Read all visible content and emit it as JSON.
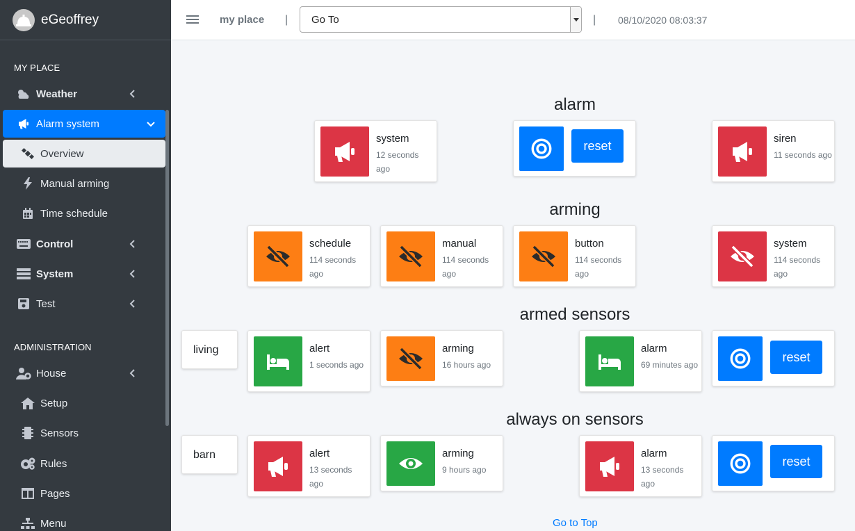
{
  "brand": {
    "name": "eGeoffrey",
    "logo_icon": "bell-icon"
  },
  "sidebar": {
    "header_myplace": "MY PLACE",
    "header_admin": "ADMINISTRATION",
    "items": [
      {
        "label": "Weather",
        "icon": "cloud-sun-icon"
      },
      {
        "label": "Alarm system",
        "icon": "bullhorn-icon"
      },
      {
        "label": "Overview",
        "icon": "satellite-icon"
      },
      {
        "label": "Manual arming",
        "icon": "bolt-icon"
      },
      {
        "label": "Time schedule",
        "icon": "calendar-icon"
      },
      {
        "label": "Control",
        "icon": "keyboard-icon"
      },
      {
        "label": "System",
        "icon": "server-icon"
      },
      {
        "label": "Test",
        "icon": "save-icon"
      },
      {
        "label": "House",
        "icon": "user-cog-icon"
      },
      {
        "label": "Setup",
        "icon": "home-icon"
      },
      {
        "label": "Sensors",
        "icon": "microchip-icon"
      },
      {
        "label": "Rules",
        "icon": "cogs-icon"
      },
      {
        "label": "Pages",
        "icon": "columns-icon"
      },
      {
        "label": "Menu",
        "icon": "sitemap-icon"
      }
    ]
  },
  "navbar": {
    "place": "my place",
    "separator": "|",
    "goto": "Go To",
    "datetime": "08/10/2020 08:03:37"
  },
  "colors": {
    "red": "#dc3545",
    "orange": "#fd7e14",
    "blue": "#007bff",
    "green": "#28a745",
    "sidebar": "#343a40"
  },
  "sections": {
    "alarm": {
      "title": "alarm",
      "system": {
        "title": "system",
        "time": "12 seconds ago",
        "icon": "bullhorn-icon"
      },
      "reset_label": "reset",
      "siren": {
        "title": "siren",
        "time": "11 seconds ago",
        "icon": "bullhorn-icon"
      }
    },
    "arming": {
      "title": "arming",
      "schedule": {
        "title": "schedule",
        "time": "114 seconds ago",
        "icon": "eye-slash-icon"
      },
      "manual": {
        "title": "manual",
        "time": "114 seconds ago",
        "icon": "eye-slash-icon"
      },
      "button": {
        "title": "button",
        "time": "114 seconds ago",
        "icon": "eye-slash-icon"
      },
      "system": {
        "title": "system",
        "time": "114 seconds ago",
        "icon": "eye-slash-icon"
      }
    },
    "armed": {
      "title": "armed sensors",
      "zone": "living",
      "alert": {
        "title": "alert",
        "time": "1 seconds ago",
        "icon": "bed-icon"
      },
      "arming": {
        "title": "arming",
        "time": "16 hours ago",
        "icon": "eye-slash-icon"
      },
      "alarm": {
        "title": "alarm",
        "time": "69 minutes ago",
        "icon": "bed-icon"
      },
      "reset_label": "reset"
    },
    "always": {
      "title": "always on sensors",
      "zone": "barn",
      "alert": {
        "title": "alert",
        "time": "13 seconds ago",
        "icon": "bullhorn-icon"
      },
      "arming": {
        "title": "arming",
        "time": "9 hours ago",
        "icon": "eye-icon"
      },
      "alarm": {
        "title": "alarm",
        "time": "13 seconds ago",
        "icon": "bullhorn-icon"
      },
      "reset_label": "reset"
    }
  },
  "footer": {
    "goto_top": "Go to Top"
  }
}
